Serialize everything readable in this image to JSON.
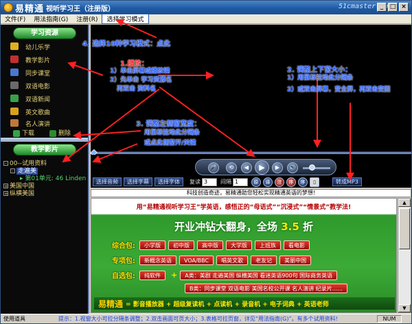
{
  "window": {
    "title": "易精通",
    "subtitle": "视听学习王（注册版）",
    "site": "51cmaster.com",
    "min": "_",
    "max": "□",
    "close": "×"
  },
  "menu": [
    "文件(F)",
    "用法指南(G)",
    "注册(R)",
    "选择学习模式"
  ],
  "sidebar": {
    "resources_header": "学习资源",
    "items": [
      "幼儿乐学",
      "教学影片",
      "同步课堂",
      "双语电影",
      "双语新闻",
      "英文歌曲",
      "名人演讲"
    ],
    "download": "下载",
    "delete": "删除",
    "films_header": "教学影片",
    "tree": {
      "root": "00--试用资料",
      "child": "走遍美",
      "lesson": "第01单元: 46 Linden",
      "n1": "美国中国",
      "n2": "纵横美国"
    }
  },
  "controls": {
    "select_audio": "选择音频",
    "select_subtitle": "选择字幕",
    "select_font": "选择字体",
    "repeat_label": "复读",
    "repeat_value": "3",
    "interval_label": "间隔",
    "interval_value": "1",
    "round_buttons": [
      "原",
      "译",
      "注",
      "序",
      "序"
    ],
    "convert": "转成MP3"
  },
  "subtitle": "科技创造奇迹，易精通助您轻松实现精通英语的梦想!",
  "ad": {
    "top": "用“易精通视听学习王”学英语，感悟正的“母语式”“沉浸式”“情景式”教学法!",
    "banner_a": "开业冲钻大翻身，全场",
    "banner_b": "3.5",
    "banner_c": "折",
    "rows": [
      {
        "key": "综合包:",
        "chips": [
          "小学版",
          "初中版",
          "高中版",
          "大学版",
          "上班族",
          "看电影"
        ]
      },
      {
        "key": "专项包:",
        "chips": [
          "新概念英语",
          "VOA/BBC",
          "唱英文歌",
          "老友记",
          "美丽中国"
        ]
      },
      {
        "key": "自选包:",
        "chips": [
          "纯软件",
          "A类：美剧 走遍美国 纵横美国 看迷英语900句 国际商务英语"
        ]
      },
      {
        "key": "",
        "chips": [
          "B类：同步课堂 双语电影 美国名校公开课 名人演讲 纪录片......"
        ]
      }
    ],
    "plus": "+",
    "bottom_brand": "易精通",
    "bottom_text": "= 影音播放器 + 超级复读机 + 点读机 + 录音机 + 电子词典 + 英语老师"
  },
  "status": {
    "left": "使用道具",
    "tip": "提示：1.视窗大小可拉分隔条调整；2.双击画面可页大小；3.表格可拉页窗，详见“用法指南(G)”。有多个试用资料!",
    "num": "NUM"
  },
  "annotations": {
    "mode": "4. 选择10种学习模式：点此",
    "play_title": "1.播放：",
    "play_1": "1）单击屏幕或播放键",
    "play_2": "2）先单击 学习资源名",
    "play_3": "再双击 资料名",
    "resize_title": "2. 调整上下窗大小：",
    "resize_1": "1）用鼠标拉动此分隔条",
    "resize_2": "2）或双击屏幕，变全屏，再双击变回",
    "left_title": "3. 调整左侧窗宽度：",
    "left_1": "用鼠标拉动此分隔条",
    "left_2": "或点此侧窗开/关键"
  },
  "colors": {
    "annotation_blue": "#2b5fff",
    "annotation_red": "#ff2a2a",
    "sidebar_text": "#e7d27a"
  }
}
